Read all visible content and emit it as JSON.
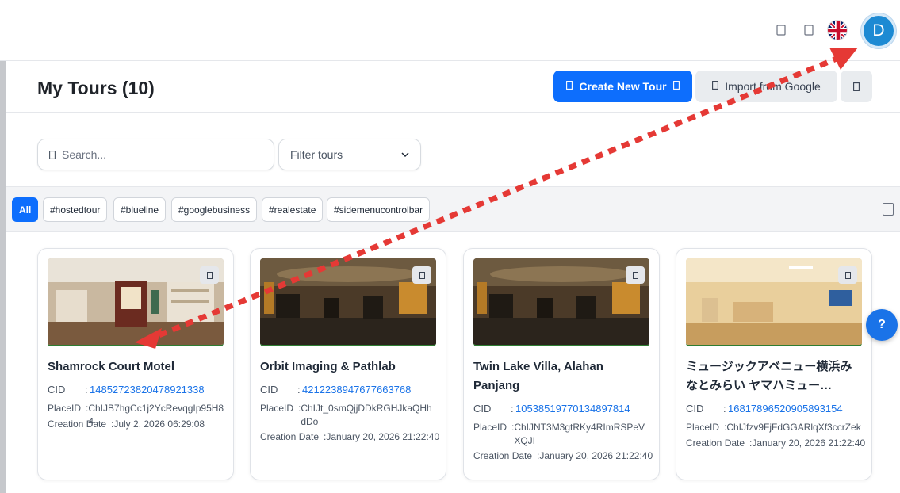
{
  "topbar": {
    "icons": [
      "bell-icon",
      "settings-icon"
    ],
    "language_flag": "uk-flag",
    "avatar_initial": "D"
  },
  "header": {
    "title": "My Tours (10)",
    "create_button": "Create New Tour",
    "import_button": "Import from Google"
  },
  "search": {
    "placeholder": "Search..."
  },
  "filter": {
    "label": "Filter tours"
  },
  "tags": [
    "All",
    "#hostedtour",
    "#blueline",
    "#googlebusiness",
    "#realestate",
    "#sidemenucontrolbar"
  ],
  "tours": [
    {
      "title": "Shamrock Court Motel",
      "cid_label": "CID",
      "cid": "14852723820478921338",
      "placeid_label": "PlaceID",
      "placeid": "ChIJB7hgCc1j2YcRevqgIp95H84",
      "date_label": "Creation Date",
      "date": "July 2, 2026 06:29:08"
    },
    {
      "title": "Orbit Imaging & Pathlab",
      "cid_label": "CID",
      "cid": "4212238947677663768",
      "placeid_label": "PlaceID",
      "placeid": "ChIJt_0smQjjDDkRGHJkaQHhdDo",
      "date_label": "Creation Date",
      "date": "January 20, 2026 21:22:40"
    },
    {
      "title": "Twin Lake Villa, Alahan Panjang",
      "cid_label": "CID",
      "cid": "10538519770134897814",
      "placeid_label": "PlaceID",
      "placeid": "ChIJNT3M3gtRKy4RImRSPeVXQJI",
      "date_label": "Creation Date",
      "date": "January 20, 2026 21:22:40"
    },
    {
      "title": "ミュージックアベニュー横浜みなとみらい ヤマハミュー…",
      "cid_label": "CID",
      "cid": "16817896520905893154",
      "placeid_label": "PlaceID",
      "placeid": "ChIJfzv9FjFdGGARlqXf3ccrZek",
      "date_label": "Creation Date",
      "date": "January 20, 2026 21:22:40"
    }
  ],
  "help": {
    "label": "?"
  },
  "colors": {
    "primary": "#0d6efd",
    "link": "#1a73e8",
    "annotation": "#e53935"
  }
}
